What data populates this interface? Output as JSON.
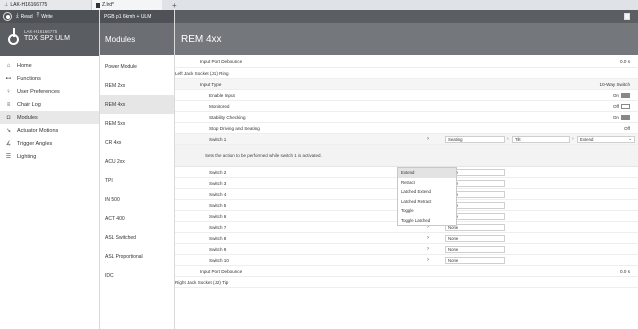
{
  "tabs": {
    "device": "LAK-H16166775",
    "file": "Z.lrd*",
    "plus": "+"
  },
  "toolbar": {
    "read_label": "Read",
    "write_label": "Write",
    "prog_label": "PGB p1 6kmh + ULM"
  },
  "device": {
    "id": "LAK-H16166775",
    "name": "TDX SP2 ULM"
  },
  "nav": [
    {
      "label": "Home",
      "icon": "home-icon"
    },
    {
      "label": "Functions",
      "icon": "functions-icon"
    },
    {
      "label": "User Preferences",
      "icon": "user-icon"
    },
    {
      "label": "Chair Log",
      "icon": "log-icon"
    },
    {
      "label": "Modules",
      "icon": "modules-icon",
      "active": true
    },
    {
      "label": "Actuator Motions",
      "icon": "actuator-icon"
    },
    {
      "label": "Trigger Angles",
      "icon": "trigger-icon"
    },
    {
      "label": "Lighting",
      "icon": "lighting-icon"
    }
  ],
  "modules": {
    "header": "Modules",
    "items": [
      "Power Module",
      "REM 2xx",
      "REM 4xx",
      "REM 5xx",
      "CR 4xx",
      "ACU 2xx",
      "TPI",
      "IN 500",
      "ACT 400",
      "ASL Switched",
      "ASL Proportional",
      "IDC"
    ]
  },
  "main": {
    "title": "REM 4xx",
    "rows": {
      "input_debounce_1": {
        "label": "Input Port Debounce",
        "value": "0.0 s"
      },
      "left_jack": {
        "label": "Left Jack Socket (J1) Ring"
      },
      "input_type": {
        "label": "Input Type",
        "value": "10-Way Switch"
      },
      "enable_input": {
        "label": "Enable Input",
        "value": "On"
      },
      "monitored": {
        "label": "Monitored",
        "value": "Off"
      },
      "stability": {
        "label": "Stability Checking",
        "value": "On"
      },
      "stop_driving": {
        "label": "Stop Driving and Seating",
        "value": "Off"
      },
      "switch1": {
        "label": "Switch 1",
        "f1": "Seating",
        "f2": "Tilt",
        "f3": "Extend"
      },
      "info": "Sets the action to be performed while switch 1 is activated.",
      "switches": [
        {
          "label": "Switch 2",
          "value": "None"
        },
        {
          "label": "Switch 3",
          "value": "None"
        },
        {
          "label": "Switch 4",
          "value": "None"
        },
        {
          "label": "Switch 5",
          "value": "None"
        },
        {
          "label": "Switch 6",
          "value": "None"
        },
        {
          "label": "Switch 7",
          "value": "None"
        },
        {
          "label": "Switch 8",
          "value": "None"
        },
        {
          "label": "Switch 9",
          "value": "None"
        },
        {
          "label": "Switch 10",
          "value": "None"
        }
      ],
      "input_debounce_2": {
        "label": "Input Port Debounce",
        "value": "0.0 s"
      },
      "right_jack": {
        "label": "Right Jack Socket (J2) Tip"
      }
    },
    "dropdown": [
      "Extend",
      "Retract",
      "Latched Extend",
      "Latched Retract",
      "Toggle",
      "Toggle Latched"
    ],
    "dropdown_selected": "Extend"
  }
}
